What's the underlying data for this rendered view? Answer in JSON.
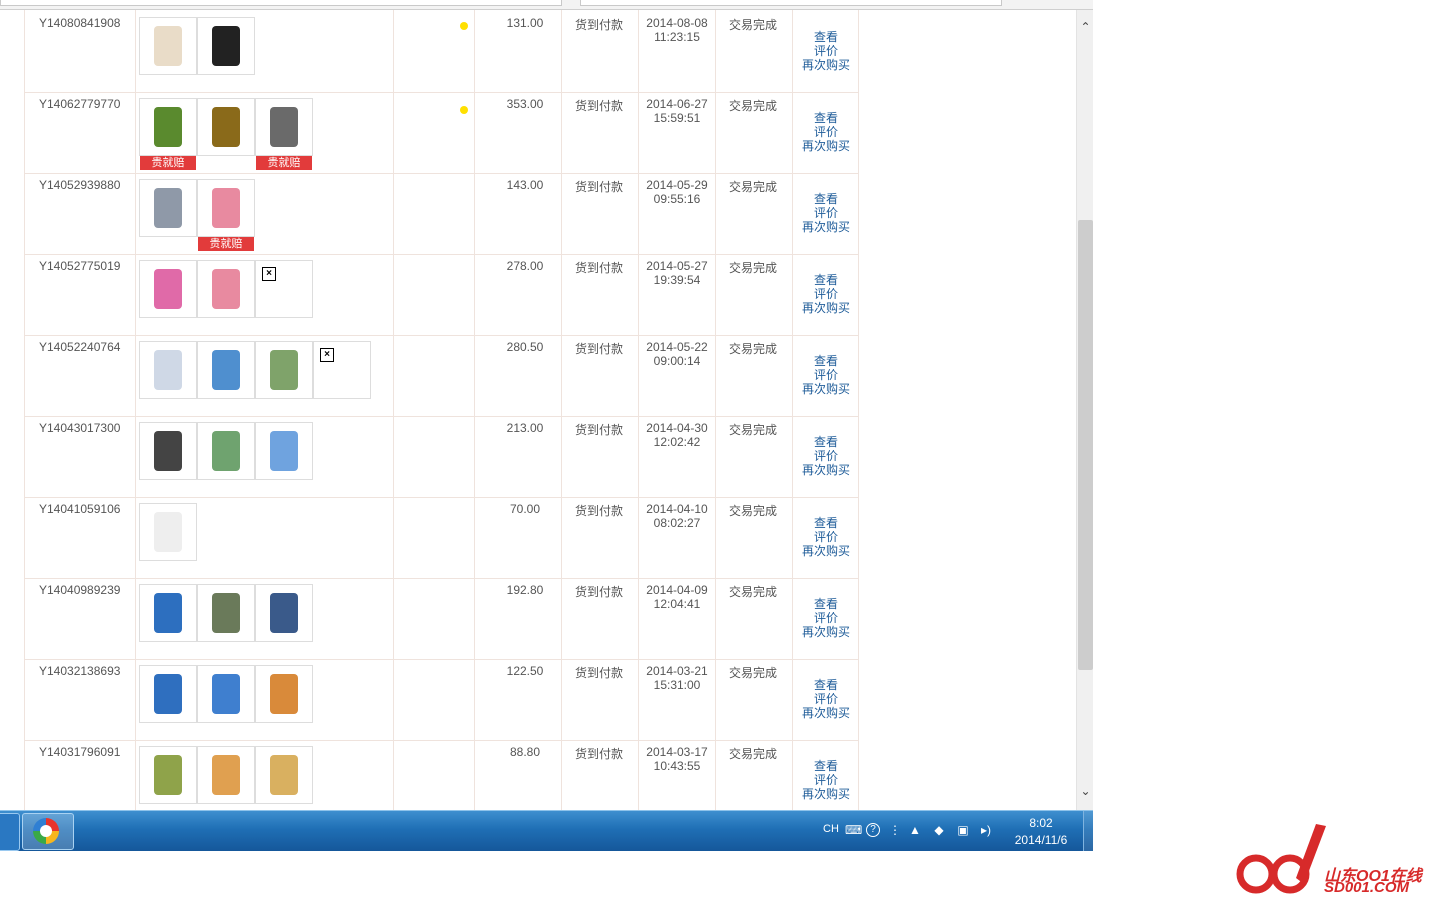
{
  "orders": [
    {
      "id": "Y14080841908",
      "price": "131.00",
      "payment": "货到付款",
      "date": "2014-08-08",
      "time": "11:23:15",
      "status": "交易完成",
      "thumbs": [
        {
          "c": "#e9dcc8",
          "badge": ""
        },
        {
          "c": "#222222",
          "badge": ""
        }
      ]
    },
    {
      "id": "Y14062779770",
      "price": "353.00",
      "payment": "货到付款",
      "date": "2014-06-27",
      "time": "15:59:51",
      "status": "交易完成",
      "thumbs": [
        {
          "c": "#5a8a2e",
          "badge": "贵就赔"
        },
        {
          "c": "#8a6a1a",
          "badge": ""
        },
        {
          "c": "#6a6a6a",
          "badge": "贵就赔"
        }
      ]
    },
    {
      "id": "Y14052939880",
      "price": "143.00",
      "payment": "货到付款",
      "date": "2014-05-29",
      "time": "09:55:16",
      "status": "交易完成",
      "thumbs": [
        {
          "c": "#8f99a8",
          "badge": ""
        },
        {
          "c": "#e88aa0",
          "badge": "贵就赔"
        }
      ]
    },
    {
      "id": "Y14052775019",
      "price": "278.00",
      "payment": "货到付款",
      "date": "2014-05-27",
      "time": "19:39:54",
      "status": "交易完成",
      "thumbs": [
        {
          "c": "#e06aa8",
          "badge": ""
        },
        {
          "c": "#e88aa0",
          "badge": ""
        },
        {
          "c": "broken",
          "badge": ""
        }
      ]
    },
    {
      "id": "Y14052240764",
      "price": "280.50",
      "payment": "货到付款",
      "date": "2014-05-22",
      "time": "09:00:14",
      "status": "交易完成",
      "thumbs": [
        {
          "c": "#cfd8e6",
          "badge": ""
        },
        {
          "c": "#4f8fcf",
          "badge": ""
        },
        {
          "c": "#7fa36a",
          "badge": ""
        },
        {
          "c": "broken",
          "badge": ""
        }
      ]
    },
    {
      "id": "Y14043017300",
      "price": "213.00",
      "payment": "货到付款",
      "date": "2014-04-30",
      "time": "12:02:42",
      "status": "交易完成",
      "thumbs": [
        {
          "c": "#444444",
          "badge": ""
        },
        {
          "c": "#6fa36f",
          "badge": ""
        },
        {
          "c": "#6fa3df",
          "badge": ""
        }
      ]
    },
    {
      "id": "Y14041059106",
      "price": "70.00",
      "payment": "货到付款",
      "date": "2014-04-10",
      "time": "08:02:27",
      "status": "交易完成",
      "thumbs": [
        {
          "c": "#eeeeee",
          "badge": ""
        }
      ]
    },
    {
      "id": "Y14040989239",
      "price": "192.80",
      "payment": "货到付款",
      "date": "2014-04-09",
      "time": "12:04:41",
      "status": "交易完成",
      "thumbs": [
        {
          "c": "#2d6fbf",
          "badge": ""
        },
        {
          "c": "#6a7a5a",
          "badge": ""
        },
        {
          "c": "#3a5a8a",
          "badge": ""
        }
      ]
    },
    {
      "id": "Y14032138693",
      "price": "122.50",
      "payment": "货到付款",
      "date": "2014-03-21",
      "time": "15:31:00",
      "status": "交易完成",
      "thumbs": [
        {
          "c": "#2f6fbf",
          "badge": ""
        },
        {
          "c": "#3f7fcf",
          "badge": ""
        },
        {
          "c": "#d98a3a",
          "badge": ""
        }
      ]
    },
    {
      "id": "Y14031796091",
      "price": "88.80",
      "payment": "货到付款",
      "date": "2014-03-17",
      "time": "10:43:55",
      "status": "交易完成",
      "thumbs": [
        {
          "c": "#8fa34a",
          "badge": ""
        },
        {
          "c": "#e0a050",
          "badge": ""
        },
        {
          "c": "#d9b060",
          "badge": ""
        }
      ]
    }
  ],
  "actions": {
    "view": "查看",
    "review": "评价",
    "rebuy": "再次购买"
  },
  "scrollbar": {
    "up_icon": "chevron-up-icon",
    "down_icon": "chevron-down-icon"
  },
  "taskbar": {
    "lang": "CH",
    "time": "8:02",
    "date": "2014/11/6"
  },
  "watermark": {
    "cn": "山东OO1在线",
    "en": "SD001.COM"
  },
  "colors": {
    "link": "#1f5c99",
    "badge": "#e23b3b",
    "taskbar": "#1f6fb5",
    "watermark": "#d72a2a"
  }
}
